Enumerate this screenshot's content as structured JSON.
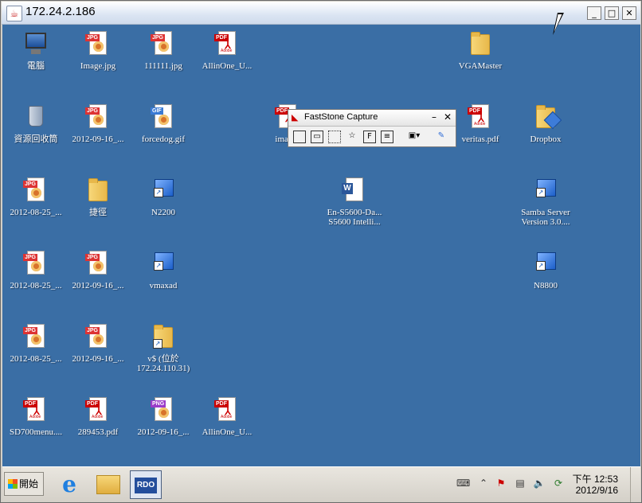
{
  "window": {
    "title": "172.24.2.186"
  },
  "desktop": {
    "icons": [
      {
        "label": "電腦"
      },
      {
        "label": "Image.jpg",
        "tag": "JPG"
      },
      {
        "label": "111111.jpg",
        "tag": "JPG"
      },
      {
        "label": "AllinOne_U...",
        "tag": "PDF"
      },
      {
        "label": "VGAMaster"
      },
      {
        "label": "資源回收筒"
      },
      {
        "label": "2012-09-16_...",
        "tag": "JPG"
      },
      {
        "label": "forcedog.gif",
        "tag": "GIF"
      },
      {
        "label": "images",
        "tag": "PDF"
      },
      {
        "label": "veritas.pdf",
        "tag": "PDF"
      },
      {
        "label": "Dropbox"
      },
      {
        "label": "2012-08-25_...",
        "tag": "JPG"
      },
      {
        "label": "捷徑"
      },
      {
        "label": "N2200"
      },
      {
        "label": "En-S5600-Da...\nS5600 Intelli..."
      },
      {
        "label": "Samba Server\nVersion 3.0...."
      },
      {
        "label": "2012-08-25_...",
        "tag": "JPG"
      },
      {
        "label": "2012-09-16_...",
        "tag": "JPG"
      },
      {
        "label": "vmaxad"
      },
      {
        "label": "N8800"
      },
      {
        "label": "2012-08-25_...",
        "tag": "JPG"
      },
      {
        "label": "2012-09-16_...",
        "tag": "JPG"
      },
      {
        "label": "v$ (位於\n172.24.110.31)"
      },
      {
        "label": "SD700menu....",
        "tag": "PDF"
      },
      {
        "label": "289453.pdf",
        "tag": "PDF"
      },
      {
        "label": "2012-09-16_...",
        "tag": "PNG"
      },
      {
        "label": "AllinOne_U...",
        "tag": "PDF"
      }
    ]
  },
  "faststone": {
    "title": "FastStone Capture"
  },
  "taskbar": {
    "start_label": "開始",
    "rdo_label": "RDO",
    "clock_time": "下午 12:53",
    "clock_date": "2012/9/16"
  },
  "colors": {
    "desktop": "#3a6ea5",
    "jpg_tag": "#d33",
    "pdf_tag": "#c00",
    "gif_tag": "#3a7bd5",
    "png_tag": "#9b3cc9"
  }
}
